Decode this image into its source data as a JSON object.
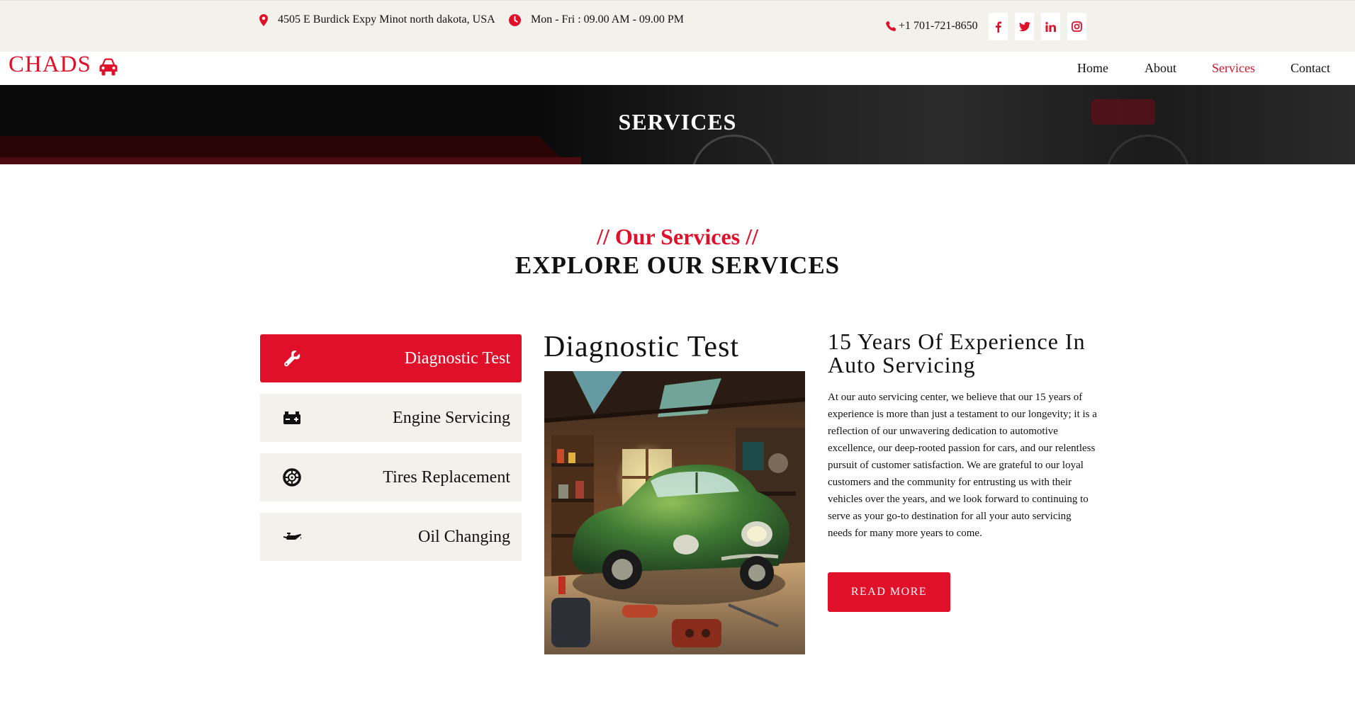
{
  "topbar": {
    "address": "4505 E Burdick Expy Minot north dakota, USA",
    "hours": "Mon - Fri : 09.00 AM - 09.00 PM",
    "phone": "+1 701-721-8650",
    "socials": [
      "facebook-icon",
      "twitter-icon",
      "linkedin-icon",
      "instagram-icon"
    ]
  },
  "brand": {
    "name": "CHADS",
    "icon": "car-icon",
    "color": "#e0102a"
  },
  "nav": {
    "home": "Home",
    "about": "About",
    "services": "Services",
    "contact": "Contact",
    "active": "Services"
  },
  "hero": {
    "title": "SERVICES"
  },
  "section": {
    "subtitle": "// Our Services //",
    "title": "EXPLORE OUR SERVICES"
  },
  "tabs": [
    {
      "label": "Diagnostic Test",
      "icon": "wrench-icon",
      "active": true
    },
    {
      "label": "Engine Servicing",
      "icon": "car-battery-icon",
      "active": false
    },
    {
      "label": "Tires Replacement",
      "icon": "tire-icon",
      "active": false
    },
    {
      "label": "Oil Changing",
      "icon": "oil-can-icon",
      "active": false
    }
  ],
  "detail": {
    "title": "Diagnostic Test",
    "image": "garage-green-car-illustration"
  },
  "experience": {
    "title": "15 Years Of Experience In Auto Servicing",
    "text": "At our auto servicing center, we believe that our 15 years of experience is more than just a testament to our longevity; it is a reflection of our unwavering dedication to automotive excellence, our deep-rooted passion for cars, and our relentless pursuit of customer satisfaction. We are grateful to our loyal customers and the community for entrusting us with their vehicles over the years, and we look forward to continuing to serve as your go-to destination for all your auto servicing needs for many more years to come.",
    "button": "READ MORE"
  },
  "colors": {
    "accent": "#e0102a",
    "topbar_bg": "#f2f1ec",
    "tab_bg": "#f2f1ec"
  }
}
